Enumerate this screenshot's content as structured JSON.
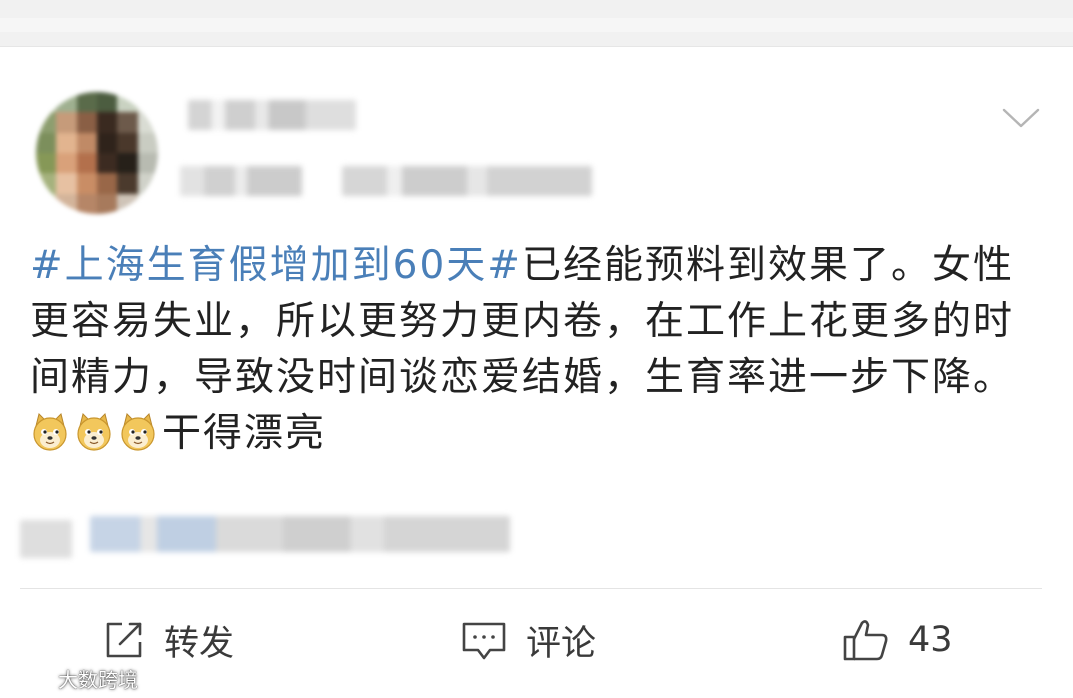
{
  "post": {
    "hashtag": "#上海生育假增加到60天#",
    "text_before_emoji": "已经能预料到效果了。女性更容易失业，所以更努力更内卷，在工作上花更多的时间精力，导致没时间谈恋爱结婚，生育率进一步下降。",
    "emoji": [
      "doge",
      "doge",
      "doge"
    ],
    "text_after_emoji": "干得漂亮"
  },
  "actions": {
    "repost_label": "转发",
    "comment_label": "评论",
    "like_count": "43"
  },
  "icons": {
    "more": "chevron-down-icon",
    "repost": "share-square-icon",
    "comment": "comment-bubble-icon",
    "like": "thumbs-up-icon"
  },
  "watermark": {
    "text": "大数跨境"
  },
  "colors": {
    "hashtag": "#4a7fb8",
    "text": "#222222",
    "icon": "#444444",
    "divider": "#e4e4e4"
  }
}
